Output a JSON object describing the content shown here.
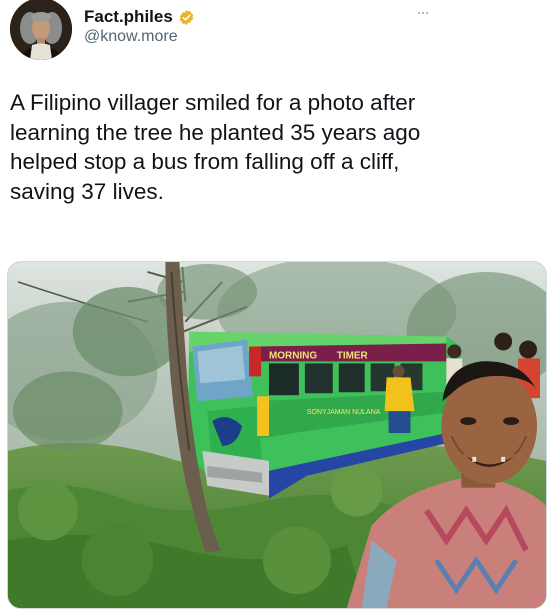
{
  "author": {
    "display_name": "Fact.philes",
    "handle": "@know.more",
    "verified": true,
    "avatar_icon": "portrait-avatar-icon"
  },
  "menu": {
    "more_icon": "more-horizontal-icon"
  },
  "tweet": {
    "text": "A Filipino villager smiled for a photo after\nlearning the tree he planted 35 years ago\nhelped stop a bus from falling off a cliff,\nsaving 37 lives."
  },
  "media": {
    "bus_signs": [
      "MORNING",
      "TIMER"
    ],
    "bus_side_text": "SONYJAMAN NULANA"
  },
  "colors": {
    "text_primary": "#0f1419",
    "text_secondary": "#536471",
    "verified_badge": "#e8b52b",
    "border": "#cfd9de"
  }
}
